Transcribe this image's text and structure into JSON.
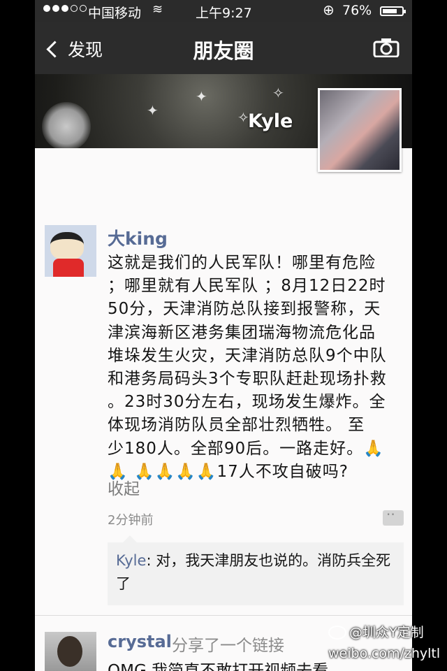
{
  "status_bar": {
    "carrier": "中国移动",
    "time": "上午9:27",
    "battery": "76%",
    "battery_level": 0.76
  },
  "nav": {
    "back_label": "发现",
    "title": "朋友圈",
    "camera_icon": "camera-icon"
  },
  "cover": {
    "name": "Kyle"
  },
  "post": {
    "author": "大king",
    "lines": [
      "这就是我们的人民军队！哪里有危险",
      "；哪里就有人民军队 ；8月12日22时",
      "50分，天津消防总队接到报警称，天",
      "津滨海新区港务集团瑞海物流危化品",
      "堆垛发生火灾，天津消防总队9个中队",
      "和港务局码头3个专职队赶赴现场扑救",
      "。23时30分左右，现场发生爆炸。全",
      "体现场消防队员全部壮烈牺牲。 至",
      "少180人。全部90后。一路走好。🙏",
      "🙏 🙏🙏🙏🙏17人不攻自破吗?"
    ],
    "collapse_label": "收起",
    "time": "2分钟前",
    "comment": {
      "name": "Kyle",
      "text": ": 对，我天津朋友也说的。消防兵全死了"
    }
  },
  "post2": {
    "author": "crystal",
    "action": "分享了一个链接",
    "text": "OMG 我简直不敢打开视频去看"
  },
  "watermark": {
    "line1": "@圳众Y定制",
    "line2": "weibo.com/zhyltl"
  }
}
